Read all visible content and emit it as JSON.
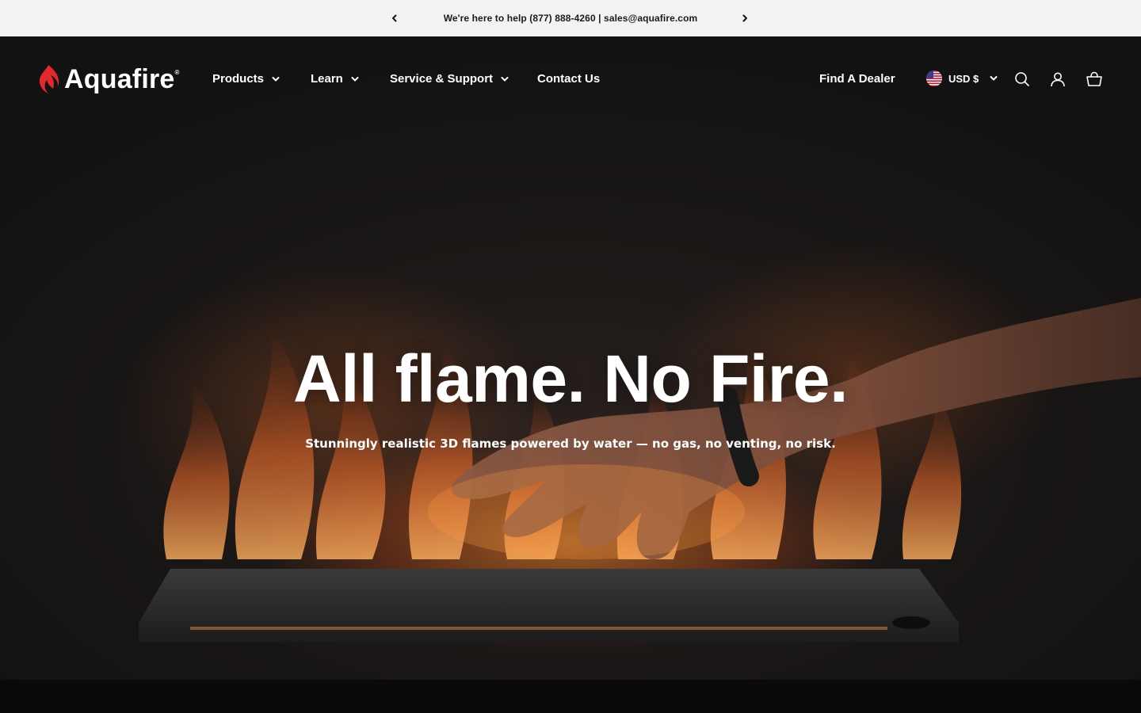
{
  "announcement": {
    "text": "We're here to help (877) 888-4260 | sales@aquafire.com",
    "prev_icon": "chevron-left-icon",
    "next_icon": "chevron-right-icon"
  },
  "header": {
    "logo_text": "Aquafire",
    "logo_mark": "®",
    "nav": [
      {
        "label": "Products"
      },
      {
        "label": "Learn"
      },
      {
        "label": "Service & Support"
      },
      {
        "label": "Contact Us"
      }
    ],
    "find_dealer": "Find A Dealer",
    "currency": "USD $",
    "icons": [
      "search-icon",
      "account-icon",
      "cart-icon"
    ]
  },
  "hero": {
    "headline": "All flame. No Fire.",
    "subheadline": "Stunningly realistic 3D flames powered by water — no gas, no venting, no risk."
  },
  "colors": {
    "announcement_bg": "#f3f3f3",
    "hero_bg": "#1a1716",
    "brand_red": "#e0282d",
    "flame_orange": "#ff8c28"
  }
}
